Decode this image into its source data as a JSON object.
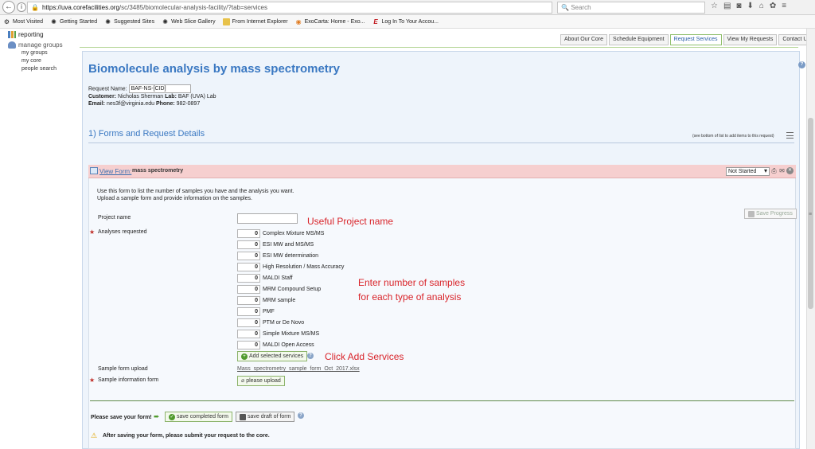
{
  "browser": {
    "url_host": "https://uva.corefacilities.org",
    "url_path": "/sc/3485/biomolecular-analysis-facility/?tab=services",
    "search_placeholder": "Search",
    "bookmarks": [
      {
        "label": "Most Visited",
        "icon": "gear-icon"
      },
      {
        "label": "Getting Started",
        "icon": "firefox-icon"
      },
      {
        "label": "Suggested Sites",
        "icon": "firefox-icon"
      },
      {
        "label": "Web Slice Gallery",
        "icon": "firefox-icon"
      },
      {
        "label": "From Internet Explorer",
        "icon": "folder-icon"
      },
      {
        "label": "ExoCarta: Home - Exo...",
        "icon": "circle-icon"
      },
      {
        "label": "Log In To Your Accou...",
        "icon": "e-icon"
      }
    ]
  },
  "leftnav": {
    "reporting": "reporting",
    "manage_groups": "manage groups",
    "my_groups": "my groups",
    "my_core": "my core",
    "people_search": "people search"
  },
  "tabs": [
    {
      "label": "About Our Core",
      "active": false
    },
    {
      "label": "Schedule Equipment",
      "active": false
    },
    {
      "label": "Request Services",
      "active": true
    },
    {
      "label": "View My Requests",
      "active": false
    },
    {
      "label": "Contact Us",
      "active": false
    }
  ],
  "page": {
    "title": "Biomolecule analysis by mass spectrometry",
    "request_name_label": "Request Name:",
    "request_name_value": "BAF-NS-[CID]",
    "customer_label": "Customer:",
    "customer_value": "Nicholas Sherman",
    "lab_label": "Lab:",
    "lab_value": "BAF (UVA) Lab",
    "email_label": "Email:",
    "email_value": "nes3f@virginia.edu",
    "phone_label": "Phone:",
    "phone_value": "982-0897"
  },
  "section": {
    "title": "1) Forms and Request Details",
    "note": "(see bottom of list to add items to this request)"
  },
  "form": {
    "view_form_link": "View Form:",
    "form_name": "mass spectrometry",
    "status": "Not Started",
    "intro_line1": "Use this form to list the number of samples you have and the analysis you want.",
    "intro_line2": "Upload a sample form and provide information on the samples.",
    "project_name_label": "Project name",
    "save_progress": "Save Progress",
    "analyses_label": "Analyses requested",
    "analyses": [
      {
        "qty": "0",
        "label": "Complex Mixture MS/MS"
      },
      {
        "qty": "0",
        "label": "ESI MW and MS/MS"
      },
      {
        "qty": "0",
        "label": "ESI MW determination"
      },
      {
        "qty": "0",
        "label": "High Resolution / Mass Accuracy"
      },
      {
        "qty": "0",
        "label": "MALDI Staff"
      },
      {
        "qty": "0",
        "label": "MRM Compound Setup"
      },
      {
        "qty": "0",
        "label": "MRM sample"
      },
      {
        "qty": "0",
        "label": "PMF"
      },
      {
        "qty": "0",
        "label": "PTM or De Novo"
      },
      {
        "qty": "0",
        "label": "Simple Mixture MS/MS"
      },
      {
        "qty": "0",
        "label": "MALDI Open Access"
      }
    ],
    "add_services": "Add selected services",
    "sample_form_upload_label": "Sample form upload",
    "sample_form_link": "Mass_spectrometry_sample_form_Oct_2017.xlsx",
    "sample_info_label": "Sample information form",
    "please_upload": "please upload",
    "save_prompt": "Please save your form!",
    "save_completed": "save completed form",
    "save_draft": "save draft of form",
    "warning": "After saving your form, please submit your request to the core."
  },
  "annotations": {
    "project_name": "Useful Project name",
    "samples_line1": "Enter number of samples",
    "samples_line2": "for each type of analysis",
    "add_services": "Click Add Services"
  },
  "colors": {
    "title_blue": "#3a78c2",
    "form_header_pink": "#f6cfcf",
    "annotation_red": "#d9242a",
    "button_green": "#4f9a2c"
  }
}
